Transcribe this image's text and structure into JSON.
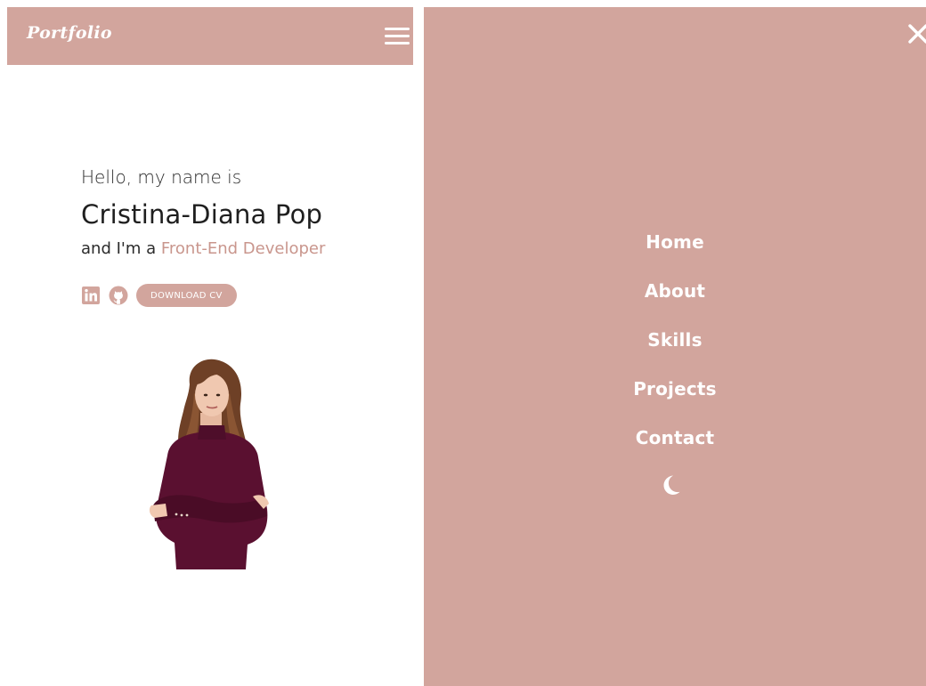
{
  "header": {
    "logo": "Portfolio",
    "menu_icon": "hamburger-menu-icon"
  },
  "hero": {
    "greeting": "Hello, my name is",
    "name": "Cristina-Diana Pop",
    "role_prefix": "and I'm a ",
    "role": "Front-End Developer"
  },
  "social": {
    "linkedin_icon": "linkedin-icon",
    "github_icon": "github-icon",
    "cv_label": "DOWNLOAD CV"
  },
  "menu": {
    "close_icon": "close-icon",
    "items": [
      {
        "label": "Home"
      },
      {
        "label": "About"
      },
      {
        "label": "Skills"
      },
      {
        "label": "Projects"
      },
      {
        "label": "Contact"
      }
    ],
    "theme_icon": "moon-icon"
  },
  "colors": {
    "accent": "#d2a59d",
    "accent_text": "#c9968d",
    "text_dark": "#1f1f1f",
    "white": "#ffffff"
  }
}
